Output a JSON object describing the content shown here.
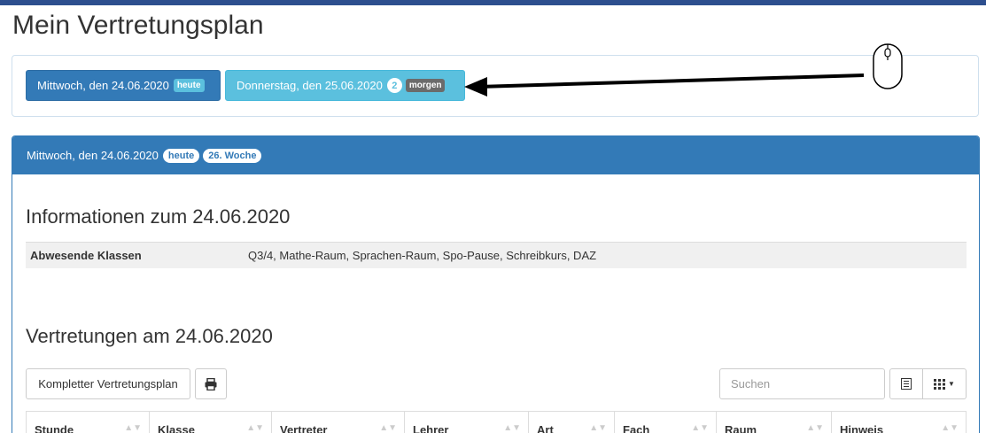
{
  "title": "Mein Vertretungsplan",
  "days": [
    {
      "label": "Mittwoch, den 24.06.2020",
      "badge": "heute"
    },
    {
      "label": "Donnerstag, den 25.06.2020",
      "count": "2",
      "badge": "morgen"
    }
  ],
  "panel": {
    "date": "Mittwoch, den 24.06.2020",
    "badge_today": "heute",
    "badge_week": "26. Woche"
  },
  "info": {
    "heading": "Informationen zum 24.06.2020",
    "key": "Abwesende Klassen",
    "value": "Q3/4, Mathe-Raum, Sprachen-Raum, Spo-Pause, Schreibkurs, DAZ"
  },
  "vertretungen": {
    "heading": "Vertretungen am 24.06.2020",
    "full_plan_label": "Kompletter Vertretungsplan",
    "search_placeholder": "Suchen"
  },
  "columns": [
    "Stunde",
    "Klasse",
    "Vertreter",
    "Lehrer",
    "Art",
    "Fach",
    "Raum",
    "Hinweis"
  ],
  "icons": {
    "print": "print-icon",
    "list": "list-icon",
    "grid": "grid-icon",
    "mouse": "mouse-icon"
  },
  "colors": {
    "primary": "#337ab7",
    "info": "#5bc0de",
    "topbar": "#2d4f8e"
  }
}
